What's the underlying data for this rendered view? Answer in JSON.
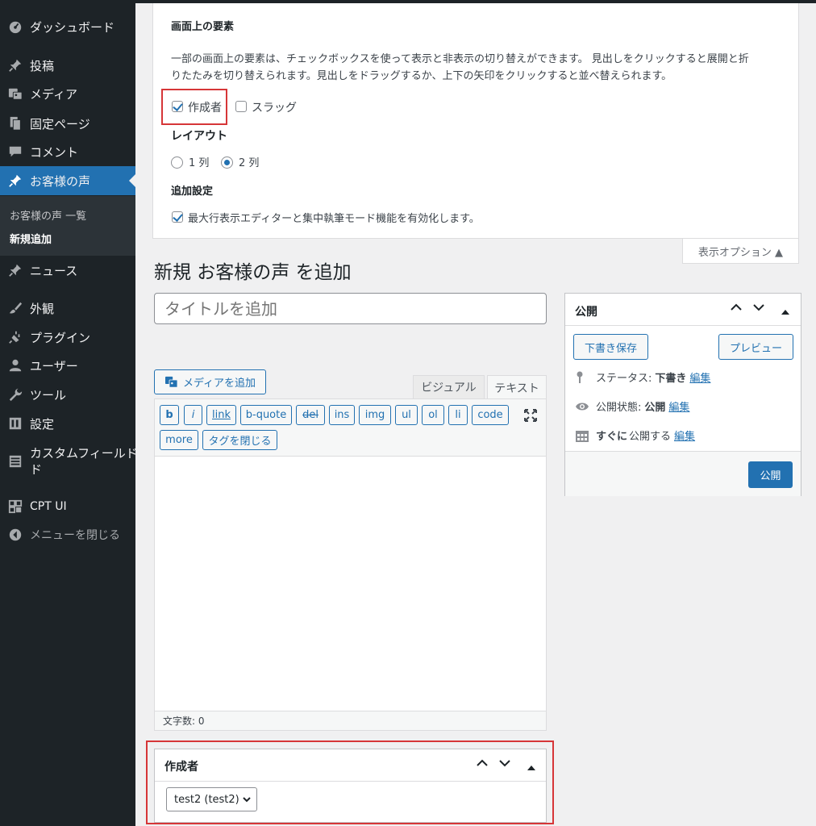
{
  "sidebar": {
    "items": [
      {
        "label": "ダッシュボード",
        "icon": "dashboard-icon"
      },
      {
        "label": "投稿",
        "icon": "pin-icon"
      },
      {
        "label": "メディア",
        "icon": "media-icon"
      },
      {
        "label": "固定ページ",
        "icon": "page-icon"
      },
      {
        "label": "コメント",
        "icon": "comment-icon"
      },
      {
        "label": "お客様の声",
        "icon": "pin-icon"
      },
      {
        "label": "ニュース",
        "icon": "pin-icon"
      },
      {
        "label": "外観",
        "icon": "brush-icon"
      },
      {
        "label": "プラグイン",
        "icon": "plugin-icon"
      },
      {
        "label": "ユーザー",
        "icon": "user-icon"
      },
      {
        "label": "ツール",
        "icon": "wrench-icon"
      },
      {
        "label": "設定",
        "icon": "settings-icon"
      },
      {
        "label": "カスタムフィールド",
        "label2": "ド",
        "icon": "custom-fields-icon"
      },
      {
        "label": "CPT UI",
        "icon": "cpt-icon"
      },
      {
        "label": "メニューを閉じる",
        "icon": "collapse-icon"
      }
    ],
    "submenu": [
      "お客様の声 一覧",
      "新規追加"
    ]
  },
  "screen_options": {
    "heading": "画面上の要素",
    "description_line1": "一部の画面上の要素は、チェックボックスを使って表示と非表示の切り替えができます。 見出しをクリックすると展開と折",
    "description_line2": "りたたみを切り替えられます。見出しをドラッグするか、上下の矢印をクリックすると並べ替えられます。",
    "checkbox_author": "作成者",
    "checkbox_slug": "スラッグ",
    "layout_heading": "レイアウト",
    "radio_1col": "1 列",
    "radio_2col": "2 列",
    "extra_heading": "追加設定",
    "extra_checkbox": "最大行表示エディターと集中執筆モード機能を有効化します。",
    "toggle_tab": "表示オプション ▲"
  },
  "page": {
    "title": "新規 お客様の声 を追加",
    "title_placeholder": "タイトルを追加"
  },
  "editor": {
    "add_media": "メディアを追加",
    "tab_visual": "ビジュアル",
    "tab_text": "テキスト",
    "quicktags": [
      "b",
      "i",
      "link",
      "b-quote",
      "del",
      "ins",
      "img",
      "ul",
      "ol",
      "li",
      "code",
      "more",
      "タグを閉じる"
    ],
    "word_count": "文字数: 0"
  },
  "publish": {
    "title": "公開",
    "save_draft": "下書き保存",
    "preview": "プレビュー",
    "status_label": "ステータス:",
    "status_value": "下書き",
    "visibility_label": "公開状態:",
    "visibility_value": "公開",
    "schedule_value": "すぐに",
    "schedule_label": "公開する",
    "edit_link": "編集",
    "publish_button": "公開"
  },
  "author_box": {
    "title": "作成者",
    "selected": "test2 (test2)"
  },
  "colors": {
    "accent": "#2271b1",
    "sidebar": "#1d2327",
    "highlight": "#d63638"
  }
}
